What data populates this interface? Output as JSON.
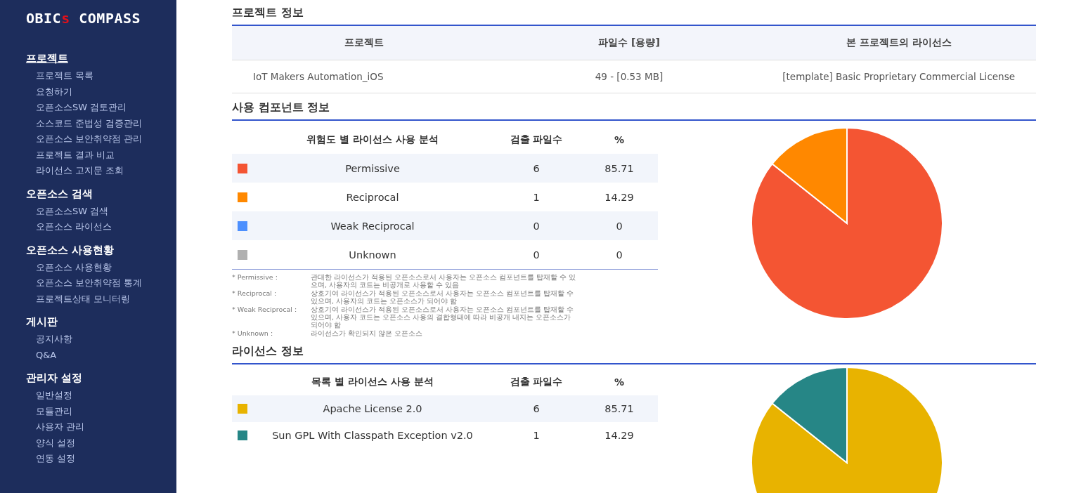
{
  "sidebar": {
    "logo": {
      "main": "OBIC",
      "accent": "s",
      "rest": " COMPASS"
    },
    "groups": [
      {
        "title": "프로젝트",
        "selected": true,
        "items": [
          {
            "label": "프로젝트 목록"
          },
          {
            "label": "요청하기"
          },
          {
            "label": "오픈소스SW 검토관리"
          },
          {
            "label": "소스코드 준법성 검증관리"
          },
          {
            "label": "오픈소스 보안취약점 관리"
          },
          {
            "label": "프로젝트 결과 비교"
          },
          {
            "label": "라이선스 고지문 조회"
          }
        ]
      },
      {
        "title": "오픈소스 검색",
        "selected": false,
        "items": [
          {
            "label": "오픈소스SW 검색"
          },
          {
            "label": "오픈소스 라이선스"
          }
        ]
      },
      {
        "title": "오픈소스 사용현황",
        "selected": false,
        "items": [
          {
            "label": "오픈소스 사용현황"
          },
          {
            "label": "오픈소스 보안취약점 통계"
          },
          {
            "label": "프로젝트상태 모니터링"
          }
        ]
      },
      {
        "title": "게시판",
        "selected": false,
        "items": [
          {
            "label": "공지사항"
          },
          {
            "label": "Q&A"
          }
        ]
      },
      {
        "title": "관리자 설정",
        "selected": false,
        "items": [
          {
            "label": "일반설정"
          },
          {
            "label": "모듈관리"
          },
          {
            "label": "사용자 관리"
          },
          {
            "label": "양식 설정"
          },
          {
            "label": "연동 설정"
          }
        ]
      }
    ]
  },
  "project_info": {
    "title": "프로젝트 정보",
    "columns": [
      "프로젝트",
      "파일수 [용량]",
      "본 프로젝트의 라이선스"
    ],
    "rows": [
      [
        "IoT Makers Automation_iOS",
        "49 - [0.53 MB]",
        "[template] Basic Proprietary Commercial License"
      ]
    ]
  },
  "components": {
    "title": "사용 컴포넌트 정보",
    "columns": [
      "위험도 별 라이선스 사용 분석",
      "검출 파일수",
      "%"
    ],
    "rows": [
      {
        "label": "Permissive",
        "color": "#f45533",
        "files": "6",
        "percent": "85.71"
      },
      {
        "label": "Reciprocal",
        "color": "#ff8800",
        "files": "1",
        "percent": "14.29"
      },
      {
        "label": "Weak Reciprocal",
        "color": "#4d90fe",
        "files": "0",
        "percent": "0"
      },
      {
        "label": "Unknown",
        "color": "#b0b0b0",
        "files": "0",
        "percent": "0"
      }
    ],
    "notes": [
      {
        "term": "* Permissive :",
        "text": "관대한 라이선스가 적용된 오픈소스로서 사용자는 오픈소스 컴포넌트를 탑재할 수 있으며, 사용자의 코드는 비공개로 사용할 수 있음"
      },
      {
        "term": "* Reciprocal :",
        "text": "상호기여 라이선스가 적용된 오픈소스로서 사용자는 오픈소스 컴포넌트를 탑재할 수 있으며, 사용자의 코드는 오픈소스가 되어야 함"
      },
      {
        "term": "* Weak Reciprocal :",
        "text": "상호기여 라이선스가 적용된 오픈소스로서 사용자는 오픈소스 컴포넌트를 탑재할 수 있으며, 사용자 코드는 오픈소스 사용의 결합형태에 따라 비공개 내지는 오픈소스가 되어야 함"
      },
      {
        "term": "* Unknown :",
        "text": "라이선스가 확인되지 않은 오픈소스"
      }
    ],
    "chart_data": {
      "type": "pie",
      "values": [
        85.71,
        14.29,
        0,
        0
      ]
    }
  },
  "licenses": {
    "title": "라이선스 정보",
    "columns": [
      "목록 별 라이선스 사용 분석",
      "검출 파일수",
      "%"
    ],
    "rows": [
      {
        "label": "Apache License 2.0",
        "color": "#e8b300",
        "files": "6",
        "percent": "85.71"
      },
      {
        "label": "Sun GPL With Classpath Exception v2.0",
        "color": "#268686",
        "files": "1",
        "percent": "14.29"
      }
    ],
    "chart_data": {
      "type": "pie",
      "values": [
        85.71,
        14.29
      ]
    }
  }
}
